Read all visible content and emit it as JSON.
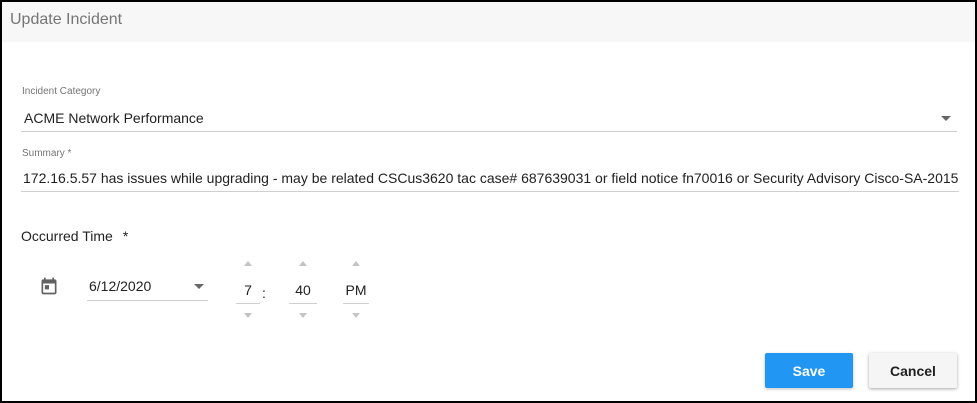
{
  "dialog": {
    "title": "Update Incident"
  },
  "category": {
    "label": "Incident Category",
    "value": "ACME Network Performance"
  },
  "summary": {
    "label": "Summary *",
    "value": "172.16.5.57 has issues while upgrading - may be related CSCus3620  tac case# 687639031 or field notice  fn70016 or Security Advisory Cisco-SA-2015"
  },
  "occurred": {
    "label": "Occurred Time",
    "required_mark": "*",
    "date": "6/12/2020",
    "hour": "7",
    "separator": ":",
    "minute": "40",
    "ampm": "PM"
  },
  "actions": {
    "save_label": "Save",
    "cancel_label": "Cancel"
  },
  "icons": {
    "calendar": "calendar-icon",
    "dropdown": "chevron-down-icon"
  },
  "colors": {
    "primary": "#2196f3",
    "header_bg": "#f7f7f7",
    "label": "#757575"
  }
}
